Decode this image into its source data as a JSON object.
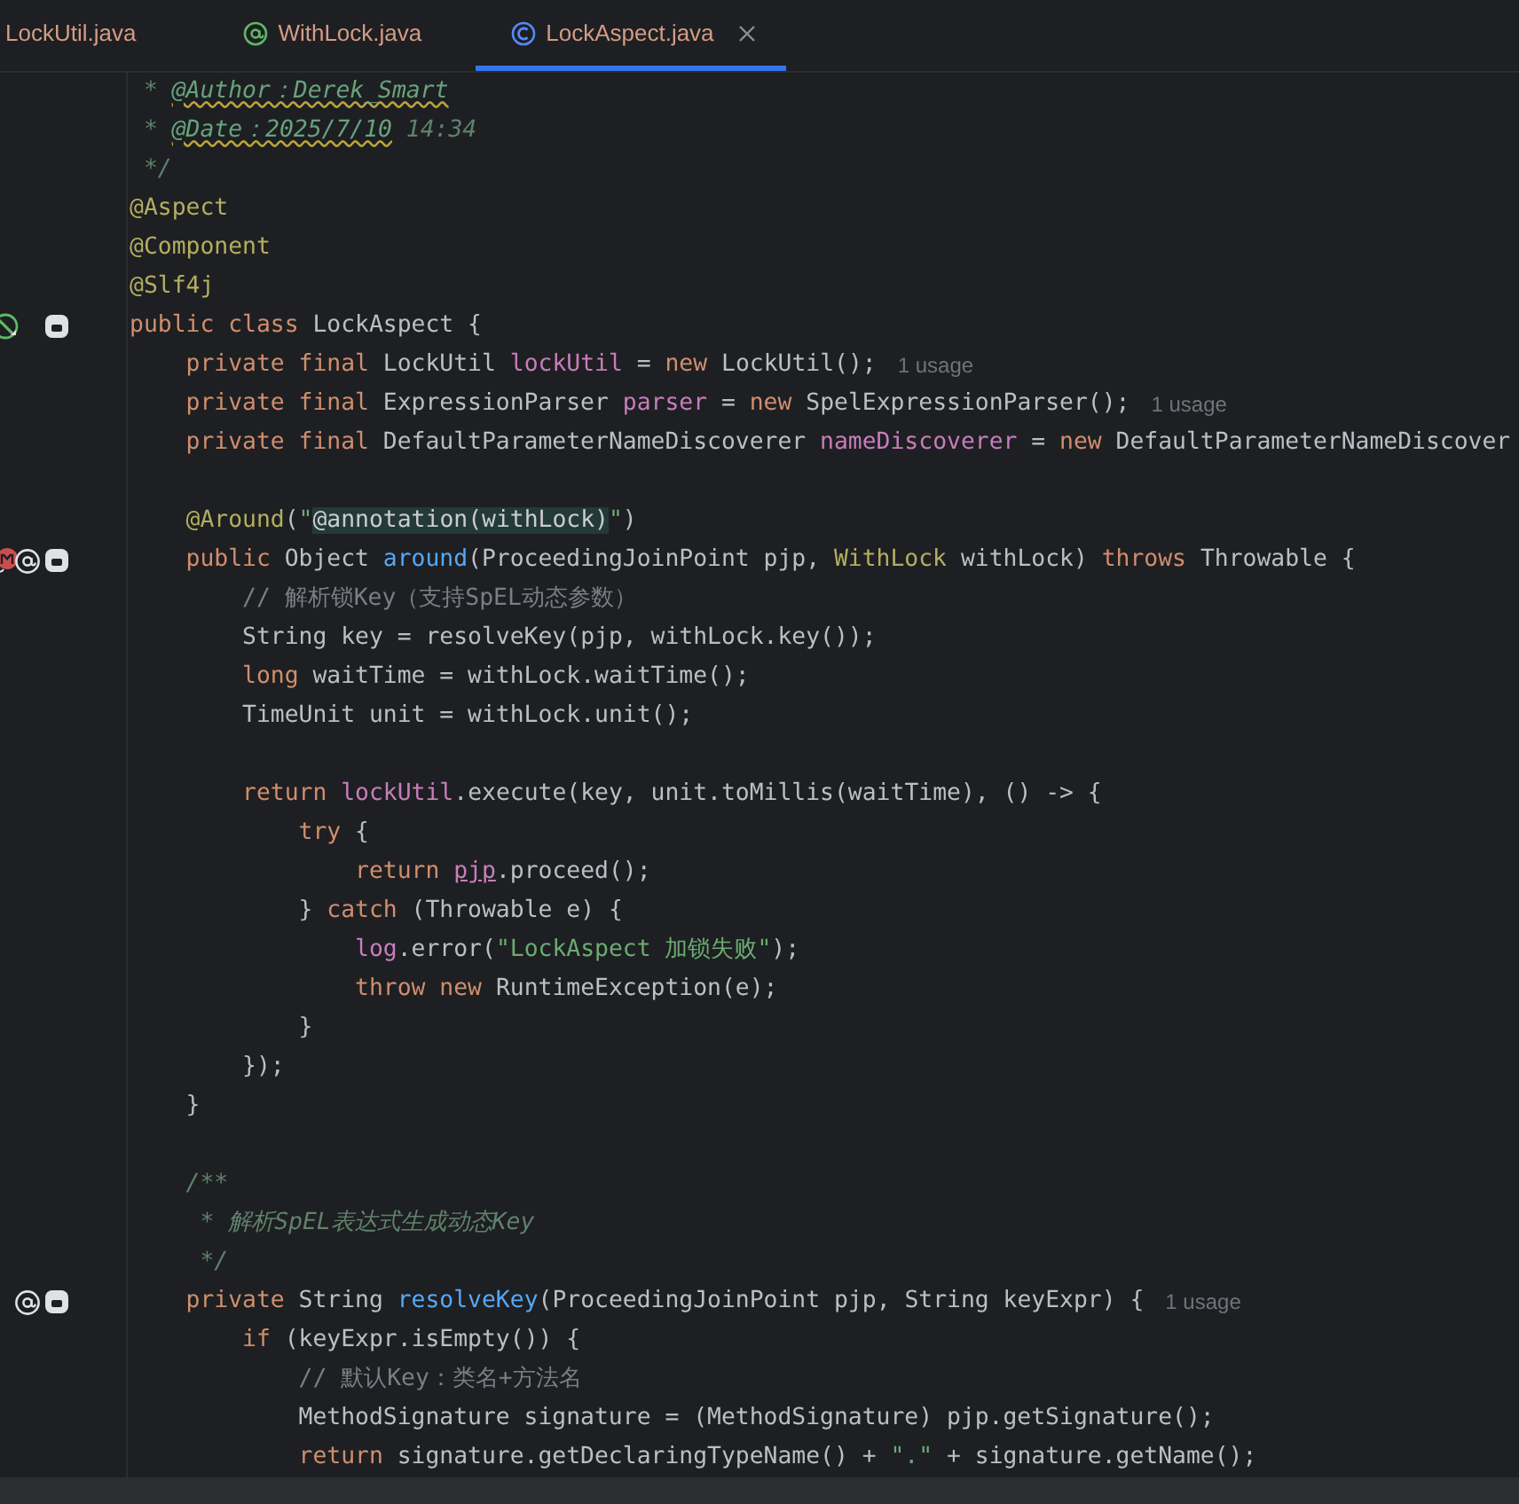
{
  "tabs": [
    {
      "label": "LockUtil.java",
      "selected": false
    },
    {
      "label": "WithLock.java",
      "selected": false
    },
    {
      "label": "LockAspect.java",
      "selected": true
    }
  ],
  "editor": {
    "lines": [
      {
        "kind": "code",
        "tokens": [
          {
            "kind": "doc",
            "text": " * "
          },
          {
            "kind": "doctag",
            "text": "@Author：Derek_Smart"
          }
        ]
      },
      {
        "kind": "code",
        "tokens": [
          {
            "kind": "doc",
            "text": " * "
          },
          {
            "kind": "doctag",
            "text": "@Date：2025/7/10"
          },
          {
            "kind": "doc",
            "text": " 14:34"
          }
        ]
      },
      {
        "kind": "code",
        "tokens": [
          {
            "kind": "doc",
            "text": " */"
          }
        ]
      },
      {
        "kind": "code",
        "tokens": [
          {
            "kind": "ann",
            "text": "@Aspect"
          }
        ]
      },
      {
        "kind": "code",
        "tokens": [
          {
            "kind": "ann",
            "text": "@Component"
          }
        ]
      },
      {
        "kind": "code",
        "tokens": [
          {
            "kind": "ann",
            "text": "@Slf4j"
          }
        ]
      },
      {
        "kind": "class",
        "tokens": [
          {
            "kind": "kw",
            "text": "public class "
          },
          {
            "kind": "plain",
            "text": "LockAspect {"
          }
        ],
        "children": [
          {
            "kind": "code",
            "tokens": [
              {
                "kind": "kw",
                "text": "private final "
              },
              {
                "kind": "plain",
                "text": "LockUtil "
              },
              {
                "kind": "field",
                "text": "lockUtil"
              },
              {
                "kind": "plain",
                "text": " = "
              },
              {
                "kind": "kw",
                "text": "new "
              },
              {
                "kind": "plain",
                "text": "LockUtil();"
              }
            ],
            "hint": "1 usage"
          },
          {
            "kind": "code",
            "tokens": [
              {
                "kind": "kw",
                "text": "private final "
              },
              {
                "kind": "plain",
                "text": "ExpressionParser "
              },
              {
                "kind": "field",
                "text": "parser"
              },
              {
                "kind": "plain",
                "text": " = "
              },
              {
                "kind": "kw",
                "text": "new "
              },
              {
                "kind": "plain",
                "text": "SpelExpressionParser();"
              }
            ],
            "hint": "1 usage"
          },
          {
            "kind": "code",
            "tokens": [
              {
                "kind": "kw",
                "text": "private final "
              },
              {
                "kind": "plain",
                "text": "DefaultParameterNameDiscoverer "
              },
              {
                "kind": "field",
                "text": "nameDiscoverer"
              },
              {
                "kind": "plain",
                "text": " = "
              },
              {
                "kind": "kw",
                "text": "new "
              },
              {
                "kind": "plain",
                "text": "DefaultParameterNameDiscover"
              }
            ]
          },
          {
            "kind": "blank"
          },
          {
            "kind": "code",
            "tokens": [
              {
                "kind": "ann",
                "text": "@Around"
              },
              {
                "kind": "plain",
                "text": "("
              },
              {
                "kind": "string",
                "text": "\""
              },
              {
                "kind": "inject",
                "text": "@annotation(withLock)"
              },
              {
                "kind": "string",
                "text": "\""
              },
              {
                "kind": "plain",
                "text": ")"
              }
            ]
          },
          {
            "kind": "advice",
            "tokens": [
              {
                "kind": "kw",
                "text": "public "
              },
              {
                "kind": "plain",
                "text": "Object "
              },
              {
                "kind": "method",
                "text": "around"
              },
              {
                "kind": "plain",
                "text": "(ProceedingJoinPoint pjp, "
              },
              {
                "kind": "ann",
                "text": "WithLock"
              },
              {
                "kind": "plain",
                "text": " withLock) "
              },
              {
                "kind": "kw",
                "text": "throws "
              },
              {
                "kind": "plain",
                "text": "Throwable {"
              }
            ],
            "children": [
              {
                "kind": "code",
                "tokens": [
                  {
                    "kind": "comment",
                    "text": "// 解析锁Key（支持SpEL动态参数）"
                  }
                ]
              },
              {
                "kind": "code",
                "tokens": [
                  {
                    "kind": "plain",
                    "text": "String key = resolveKey(pjp, withLock.key());"
                  }
                ]
              },
              {
                "kind": "code",
                "tokens": [
                  {
                    "kind": "kw",
                    "text": "long "
                  },
                  {
                    "kind": "plain",
                    "text": "waitTime = withLock.waitTime();"
                  }
                ]
              },
              {
                "kind": "code",
                "tokens": [
                  {
                    "kind": "plain",
                    "text": "TimeUnit unit = withLock.unit();"
                  }
                ]
              },
              {
                "kind": "blank"
              },
              {
                "kind": "code",
                "tokens": [
                  {
                    "kind": "kw",
                    "text": "return "
                  },
                  {
                    "kind": "field",
                    "text": "lockUtil"
                  },
                  {
                    "kind": "plain",
                    "text": ".execute(key, unit.toMillis(waitTime), () -> {"
                  }
                ],
                "children": [
                  {
                    "kind": "code",
                    "tokens": [
                      {
                        "kind": "kw",
                        "text": "try "
                      },
                      {
                        "kind": "plain",
                        "text": "{"
                      }
                    ],
                    "children": [
                      {
                        "kind": "code",
                        "tokens": [
                          {
                            "kind": "kw",
                            "text": "return "
                          },
                          {
                            "kind": "captured",
                            "text": "pjp"
                          },
                          {
                            "kind": "plain",
                            "text": ".proceed();"
                          }
                        ]
                      }
                    ]
                  },
                  {
                    "kind": "code",
                    "tokens": [
                      {
                        "kind": "plain",
                        "text": "} "
                      },
                      {
                        "kind": "kw",
                        "text": "catch "
                      },
                      {
                        "kind": "plain",
                        "text": "(Throwable e) {"
                      }
                    ],
                    "children": [
                      {
                        "kind": "code",
                        "tokens": [
                          {
                            "kind": "field",
                            "text": "log"
                          },
                          {
                            "kind": "plain",
                            "text": ".error("
                          },
                          {
                            "kind": "string",
                            "text": "\"LockAspect 加锁失败\""
                          },
                          {
                            "kind": "plain",
                            "text": ");"
                          }
                        ]
                      },
                      {
                        "kind": "code",
                        "tokens": [
                          {
                            "kind": "kw",
                            "text": "throw new "
                          },
                          {
                            "kind": "plain",
                            "text": "RuntimeException(e);"
                          }
                        ]
                      }
                    ]
                  },
                  {
                    "kind": "code",
                    "tokens": [
                      {
                        "kind": "plain",
                        "text": "}"
                      }
                    ]
                  }
                ]
              },
              {
                "kind": "code",
                "tokens": [
                  {
                    "kind": "plain",
                    "text": "});"
                  }
                ]
              }
            ]
          },
          {
            "kind": "code",
            "tokens": [
              {
                "kind": "plain",
                "text": "}"
              }
            ]
          },
          {
            "kind": "blank"
          },
          {
            "kind": "code",
            "tokens": [
              {
                "kind": "doc",
                "text": "/**"
              }
            ]
          },
          {
            "kind": "code",
            "tokens": [
              {
                "kind": "doc",
                "text": " * 解析SpEL表达式生成动态Key"
              }
            ]
          },
          {
            "kind": "code",
            "tokens": [
              {
                "kind": "doc",
                "text": " */"
              }
            ]
          },
          {
            "kind": "method",
            "tokens": [
              {
                "kind": "kw",
                "text": "private "
              },
              {
                "kind": "plain",
                "text": "String "
              },
              {
                "kind": "method",
                "text": "resolveKey"
              },
              {
                "kind": "plain",
                "text": "(ProceedingJoinPoint pjp, String keyExpr) {"
              }
            ],
            "hint": "1 usage",
            "children": [
              {
                "kind": "code",
                "tokens": [
                  {
                    "kind": "kw",
                    "text": "if "
                  },
                  {
                    "kind": "plain",
                    "text": "(keyExpr.isEmpty()) {"
                  }
                ],
                "children": [
                  {
                    "kind": "code",
                    "tokens": [
                      {
                        "kind": "comment",
                        "text": "// 默认Key：类名+方法名"
                      }
                    ]
                  },
                  {
                    "kind": "code",
                    "tokens": [
                      {
                        "kind": "plain",
                        "text": "MethodSignature signature = (MethodSignature) pjp.getSignature();"
                      }
                    ]
                  },
                  {
                    "kind": "code",
                    "tokens": [
                      {
                        "kind": "kw",
                        "text": "return "
                      },
                      {
                        "kind": "plain",
                        "text": "signature.getDeclaringTypeName() + "
                      },
                      {
                        "kind": "string",
                        "text": "\".\""
                      },
                      {
                        "kind": "plain",
                        "text": " + signature.getName();"
                      }
                    ]
                  }
                ]
              }
            ]
          }
        ]
      }
    ]
  }
}
